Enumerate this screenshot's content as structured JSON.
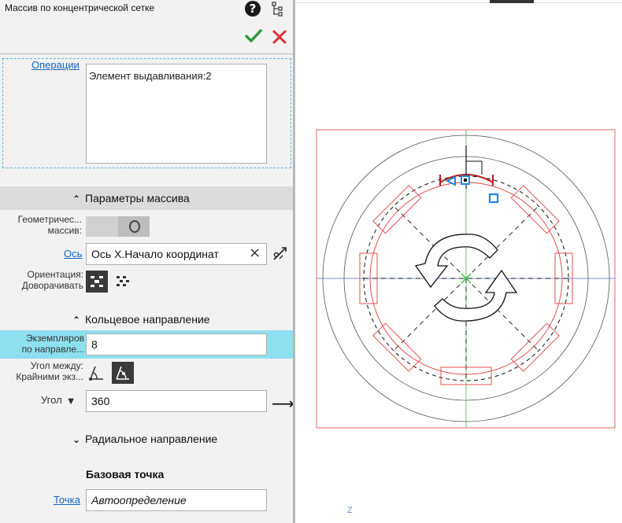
{
  "header": {
    "title": "Массив по концентрической сетке",
    "help_glyph": "?"
  },
  "operations": {
    "link_label": "Операции",
    "items": [
      "Элемент выдавливания:2"
    ]
  },
  "array_params": {
    "heading": "Параметры массива",
    "geometric_label_1": "Геометричес...",
    "geometric_label_2": "массив:",
    "axis_label": "Ось",
    "axis_value": "Ось X.Начало координат",
    "orientation_label_1": "Ориентация:",
    "orientation_label_2": "Доворачивать"
  },
  "ring_direction": {
    "heading": "Кольцевое направление",
    "count_label_1": "Экземпляров",
    "count_label_2": "по направле...",
    "count_value": "8",
    "angle_between_label_1": "Угол между:",
    "angle_between_label_2": "Крайними экз...",
    "angle_label": "Угол",
    "angle_value": "360"
  },
  "radial_direction": {
    "heading": "Радиальное направление"
  },
  "base_point": {
    "heading": "Базовая точка",
    "point_label": "Точка",
    "point_value": "Автоопределение"
  },
  "viewport": {
    "z_axis_label": "Z"
  },
  "colors": {
    "accent_blue": "#1565c0",
    "highlight_row": "#8ee0ee",
    "ok_green": "#2e9a3a",
    "cancel_red": "#e03030",
    "sketch_red": "#e34040",
    "selection_blue": "#1e88e5"
  }
}
